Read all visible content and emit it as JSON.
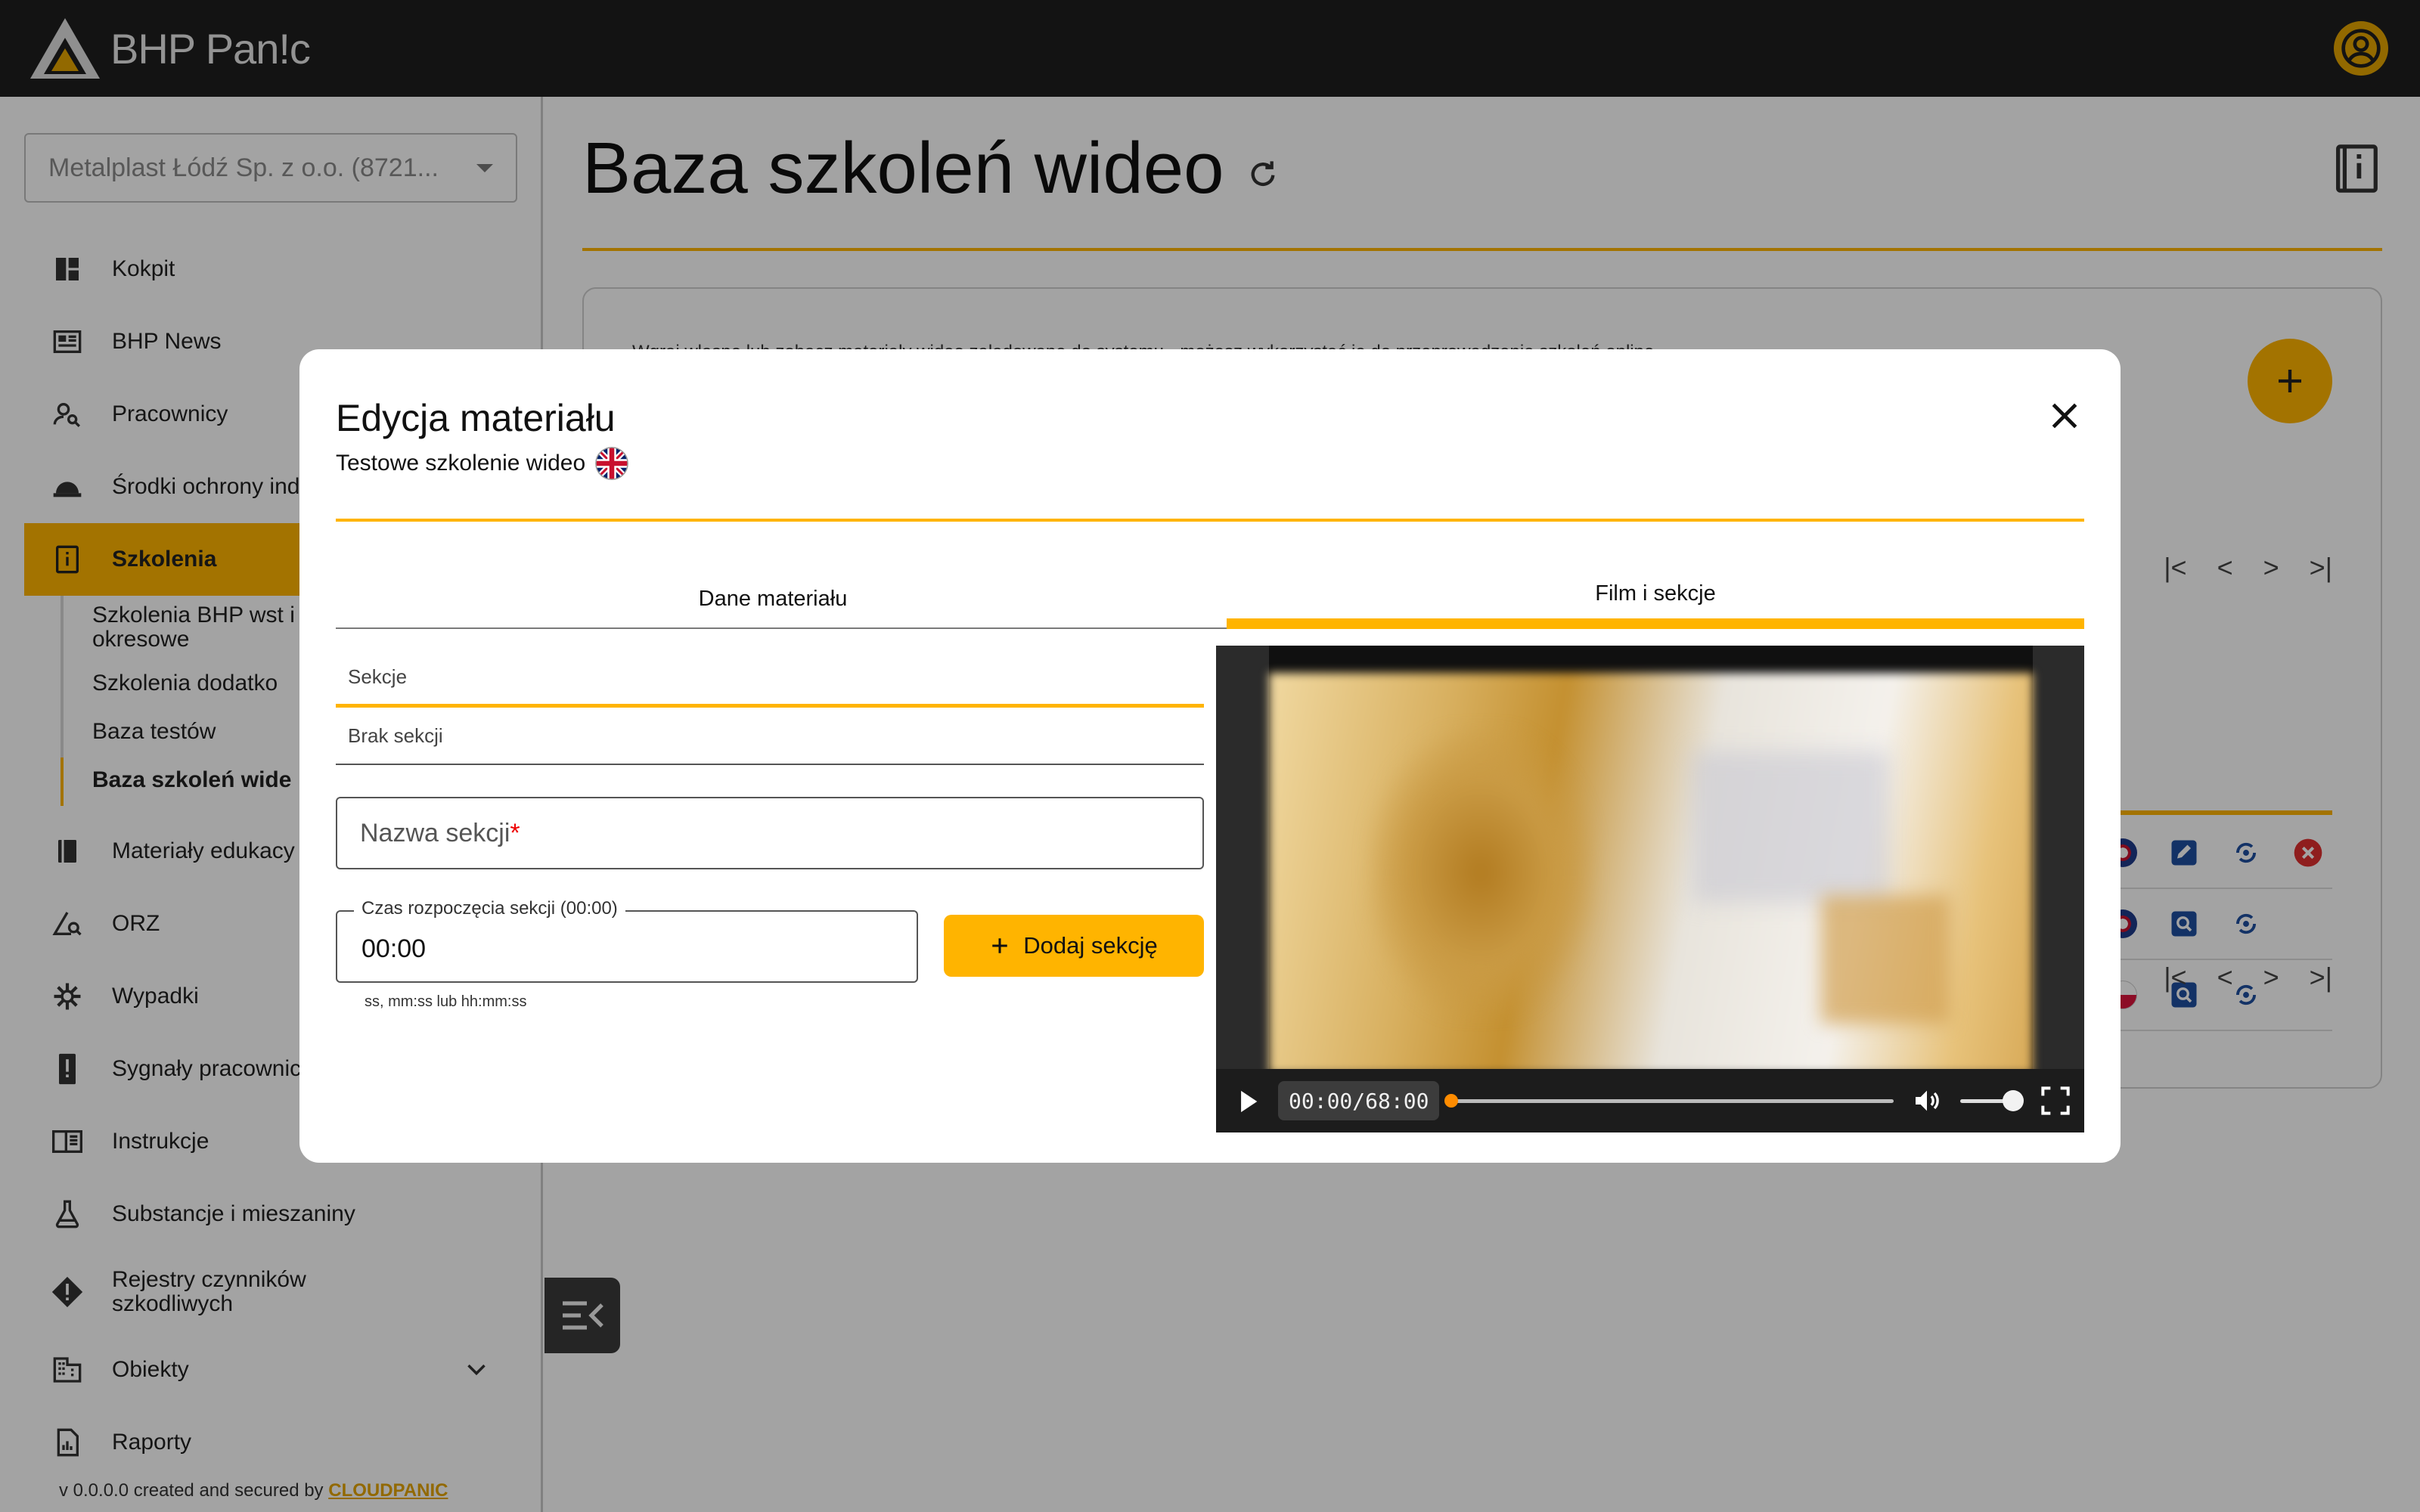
{
  "colors": {
    "accent": "#ffb400",
    "topbar": "#1e1e1e",
    "danger": "#e03030",
    "link": "#1e4fa0"
  },
  "app": {
    "logo_text": "BHP Pan!c"
  },
  "sidebar": {
    "company": "Metalplast Łódź Sp. z o.o. (8721...",
    "items": [
      {
        "label": "Kokpit",
        "icon": "dashboard-icon"
      },
      {
        "label": "BHP News",
        "icon": "news-icon"
      },
      {
        "label": "Pracownicy",
        "icon": "employees-icon"
      },
      {
        "label": "Środki ochrony ind",
        "icon": "helmet-icon"
      },
      {
        "label": "Szkolenia",
        "icon": "training-book-icon",
        "active": true
      },
      {
        "label": "Materiały edukacy",
        "icon": "book-icon"
      },
      {
        "label": "ORZ",
        "icon": "risk-icon"
      },
      {
        "label": "Wypadki",
        "icon": "accident-icon"
      },
      {
        "label": "Sygnały pracownic",
        "icon": "signal-icon"
      },
      {
        "label": "Instrukcje",
        "icon": "instructions-icon"
      },
      {
        "label": "Substancje i mieszaniny",
        "icon": "flask-icon"
      },
      {
        "label": "Rejestry czynników szkodliwych",
        "icon": "warning-icon"
      },
      {
        "label": "Obiekty",
        "icon": "building-icon"
      },
      {
        "label": "Raporty",
        "icon": "report-icon"
      }
    ],
    "subitems": [
      {
        "label": "Szkolenia BHP wst i okresowe"
      },
      {
        "label": "Szkolenia dodatko"
      },
      {
        "label": "Baza testów"
      },
      {
        "label": "Baza szkoleń wide",
        "active": true
      }
    ],
    "footer_prefix": "v 0.0.0.0 created and secured by",
    "footer_link": "CLOUDPANIC"
  },
  "main": {
    "title": "Baza szkoleń wideo",
    "card_text": "Wgraj własne lub zobacz materiały wideo załadowane do systemu - możesz wykorzystać je do przeprowadzenia szkoleń online."
  },
  "modal": {
    "title": "Edycja materiału",
    "subtitle": "Testowe szkolenie wideo",
    "tabs": [
      {
        "label": "Dane materiału"
      },
      {
        "label": "Film i sekcje",
        "active": true
      }
    ],
    "sections_header": "Sekcje",
    "sections_empty": "Brak sekcji",
    "section_name_placeholder": "Nazwa sekcji",
    "required_mark": "*",
    "start_time_label": "Czas rozpoczęcia sekcji (00:00)",
    "start_time_value": "00:00",
    "start_time_hint": "ss, mm:ss lub hh:mm:ss",
    "add_button": "Dodaj sekcję",
    "video": {
      "time": "00:00/68:00",
      "progress": 0,
      "volume": 1
    }
  }
}
